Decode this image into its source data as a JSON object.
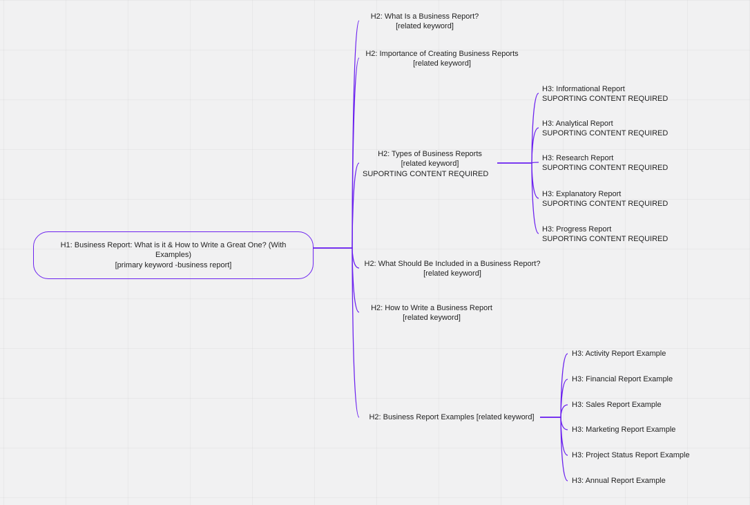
{
  "root": {
    "title": "H1: Business Report: What is it & How to Write a Great One? (With Examples)",
    "subtitle": "[primary keyword -business report]"
  },
  "h2": [
    {
      "title": "H2: What Is a Business Report?",
      "subtitle": "[related keyword]"
    },
    {
      "title": "H2: Importance of Creating Business Reports",
      "subtitle": "[related keyword]"
    },
    {
      "title": "H2: Types of Business Reports",
      "subtitle": "[related keyword]",
      "note": "SUPORTING CONTENT REQUIRED"
    },
    {
      "title": "H2: What Should Be Included in a Business Report?",
      "subtitle": "[related keyword]"
    },
    {
      "title": "H2: How to Write a Business Report",
      "subtitle": "[related keyword]"
    },
    {
      "title": "H2: Business Report Examples [related keyword]"
    }
  ],
  "types_children": [
    {
      "title": "H3: Informational Report",
      "note": "SUPORTING CONTENT REQUIRED"
    },
    {
      "title": "H3: Analytical Report",
      "note": "SUPORTING CONTENT REQUIRED"
    },
    {
      "title": "H3: Research Report",
      "note": "SUPORTING CONTENT REQUIRED"
    },
    {
      "title": "H3: Explanatory Report",
      "note": "SUPORTING CONTENT REQUIRED"
    },
    {
      "title": "H3: Progress Report",
      "note": "SUPORTING CONTENT REQUIRED"
    }
  ],
  "examples_children": [
    {
      "title": "H3: Activity Report Example"
    },
    {
      "title": "H3: Financial Report Example"
    },
    {
      "title": "H3: Sales Report Example"
    },
    {
      "title": "H3: Marketing Report Example"
    },
    {
      "title": "H3: Project Status Report Example"
    },
    {
      "title": "H3: Annual Report Example"
    }
  ]
}
